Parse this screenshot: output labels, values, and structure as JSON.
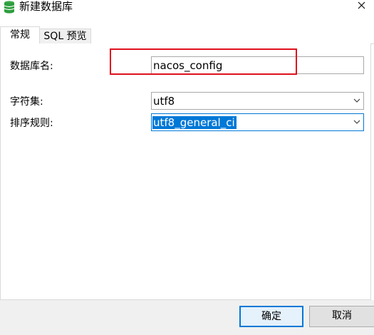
{
  "window": {
    "title": "新建数据库",
    "icon": "database-icon",
    "close_icon": "close-icon"
  },
  "tabs": [
    {
      "label": "常规",
      "active": true
    },
    {
      "label": "SQL 预览",
      "active": false
    }
  ],
  "form": {
    "db_name_label": "数据库名:",
    "db_name_value": "nacos_config",
    "charset_label": "字符集:",
    "charset_value": "utf8",
    "collation_label": "排序规则:",
    "collation_value": "utf8_general_ci"
  },
  "buttons": {
    "ok": "确定",
    "cancel": "取消"
  },
  "colors": {
    "annotation_box": "#e0101e",
    "selection": "#0078d7",
    "db_icon": "#2e9e3e"
  }
}
